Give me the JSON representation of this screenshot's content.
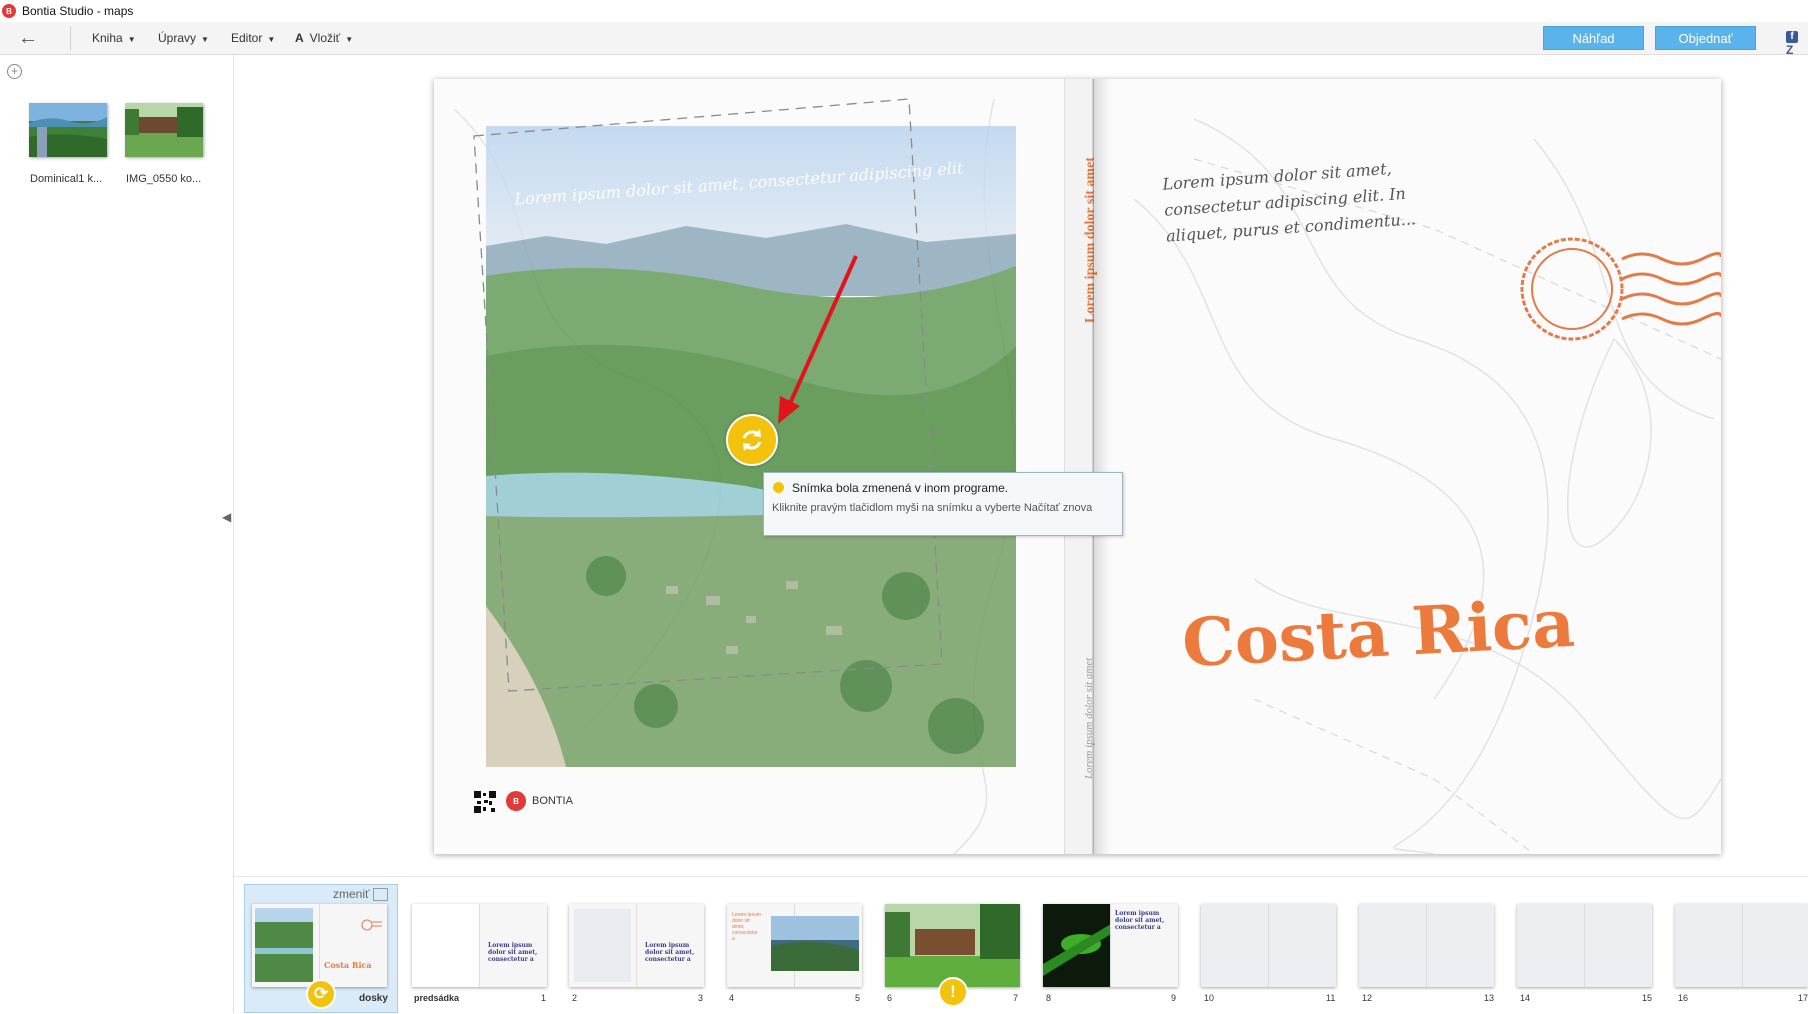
{
  "window": {
    "title": "Bontia Studio - maps"
  },
  "toolbar": {
    "menus": [
      {
        "label": "Kniha"
      },
      {
        "label": "Úpravy"
      },
      {
        "label": "Editor"
      },
      {
        "label": "Vložiť"
      }
    ],
    "preview_label": "Náhľad",
    "order_label": "Objednať",
    "facebook_label": "Z"
  },
  "library": {
    "photos": [
      {
        "name": "Dominical1 k..."
      },
      {
        "name": "IMG_0550 ko..."
      }
    ]
  },
  "book": {
    "back_cover_text": "Lorem ipsum dolor sit amet, consectetur adipiscing elit",
    "spine_title": "Lorem ipsum dolor sit amet",
    "spine_subtitle": "Lorem ipsum dolor sit amet",
    "front_script_lines": [
      "Lorem ipsum dolor sit amet,",
      "consectetur adipiscing elit. In",
      "aliquet, purus et condimentu..."
    ],
    "title": "Costa Rica",
    "brand": "BONTIA"
  },
  "tooltip": {
    "title": "Snímka bola zmenená v inom programe.",
    "body": "Kliknite pravým tlačidlom myši na snímku a vyberte Načítať znova"
  },
  "pages_strip": {
    "change_label": "zmeniť",
    "cover_label": "dosky",
    "endpaper_label": "predsádka",
    "page_numbers": [
      "1",
      "2",
      "3",
      "4",
      "5",
      "6",
      "7",
      "8",
      "9",
      "10",
      "11",
      "12",
      "13",
      "14",
      "15",
      "16",
      "17"
    ],
    "thumb_text": "Lorem ipsum dolor sit amet, consectetur a",
    "thumb_title": "Costa Rica"
  },
  "colors": {
    "accent": "#5ab3ea",
    "warning": "#f3c20c",
    "brand_orange": "#ec7a3c",
    "logo_red": "#e03a3a"
  }
}
